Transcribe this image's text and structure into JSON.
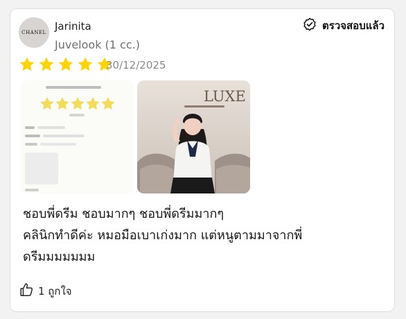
{
  "review": {
    "avatar_text": "CHANEL",
    "username": "Jarinita",
    "product": "Juvelook (1 cc.)",
    "verified_label": "ตรวจสอบแล้ว",
    "rating": 5,
    "max_rating": 5,
    "date": "30/12/2025",
    "text_lines": [
      "ชอบพี่ดรีม ชอบมากๆ ชอบพี่ดรีมมากๆ",
      "คลินิกทำดีค่ะ หมอมือเบาเก่งมาก แต่หนูตามมาจากพี่",
      "ดรีมมมมมมม"
    ],
    "helpful_label": "1 ถูกใจ",
    "photos": [
      {
        "name": "review-screenshot"
      },
      {
        "name": "clinic-photo",
        "sign_text": "LUXE"
      }
    ]
  },
  "colors": {
    "star": "#FFD400",
    "muted": "#707070",
    "date": "#8a8a8a"
  },
  "icons": {
    "verified": "verified-badge-icon",
    "star": "star-icon",
    "helpful": "thumbs-up-icon"
  }
}
